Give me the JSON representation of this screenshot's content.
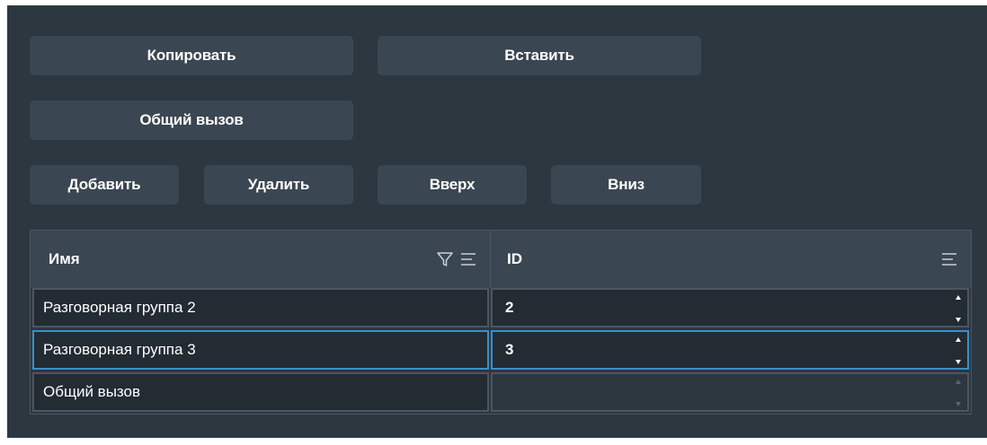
{
  "buttons": {
    "copy": "Копировать",
    "paste": "Вставить",
    "group_call": "Общий вызов",
    "add": "Добавить",
    "delete": "Удалить",
    "up": "Вверх",
    "down": "Вниз"
  },
  "table": {
    "columns": {
      "name": "Имя",
      "id": "ID"
    },
    "rows": [
      {
        "name": "Разговорная группа 2",
        "id": "2"
      },
      {
        "name": "Разговорная группа 3",
        "id": "3"
      },
      {
        "name": "Общий вызов",
        "id": ""
      }
    ]
  },
  "icons": {
    "filter": "filter-icon",
    "sort_name": "menu-lines-icon",
    "sort_id": "menu-lines-icon",
    "spinner": "spin-arrows-icon"
  },
  "colors": {
    "background": "#2d3740",
    "button": "#3a4651",
    "cell": "#232b33",
    "border": "#4b5661",
    "selected_border": "#3b8fc7",
    "text": "#ffffff"
  }
}
